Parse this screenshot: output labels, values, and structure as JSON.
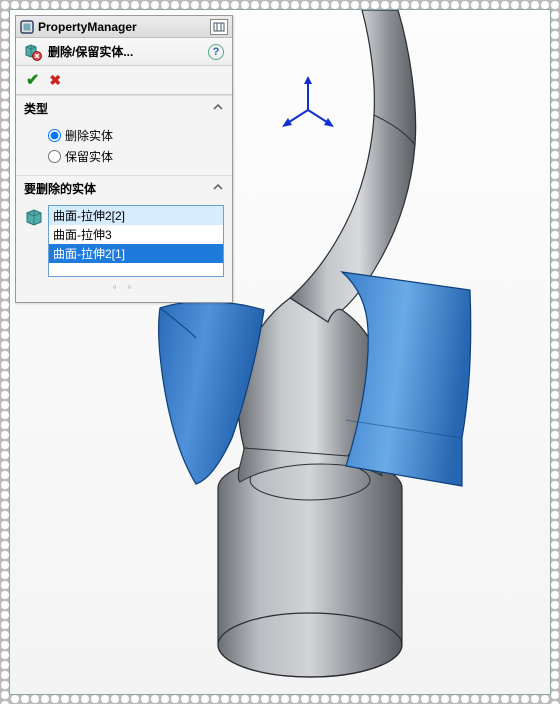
{
  "panel": {
    "title": "PropertyManager",
    "feature_label": "删除/保留实体...",
    "section_type": {
      "title": "类型",
      "option_delete": "删除实体",
      "option_keep": "保留实体",
      "selected": "delete"
    },
    "section_list": {
      "title": "要删除的实体",
      "items": [
        "曲面-拉伸2[2]",
        "曲面-拉伸3",
        "曲面-拉伸2[1]"
      ],
      "selected_index": 2
    }
  },
  "colors": {
    "surface_blue": "#2f74c3",
    "surface_blue_light": "#5a9de0",
    "body_gray": "#9aa0a6",
    "body_gray_dark": "#6d7278",
    "body_gray_light": "#c1c5c9",
    "edge": "#2a2d31"
  }
}
